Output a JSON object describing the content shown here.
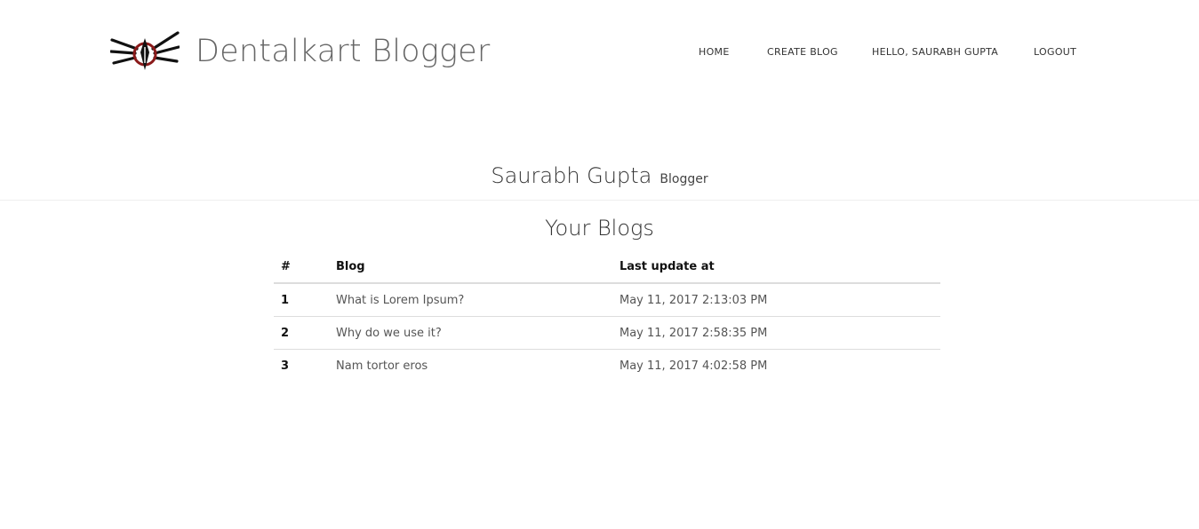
{
  "brand": {
    "title": "Dentalkart Blogger",
    "logo_icon": "winged-pen-logo-icon",
    "logo_accent_color": "#8b1a1a"
  },
  "nav": {
    "home": "HOME",
    "create_blog": "CREATE BLOG",
    "hello": "HELLO,  SAURABH GUPTA",
    "logout": "LOGOUT"
  },
  "profile": {
    "name": "Saurabh Gupta",
    "role": "Blogger"
  },
  "blogs": {
    "heading": "Your Blogs",
    "columns": [
      "#",
      "Blog",
      "Last update at"
    ],
    "rows": [
      {
        "num": "1",
        "title": "What is Lorem Ipsum?",
        "updated": "May 11, 2017 2:13:03 PM"
      },
      {
        "num": "2",
        "title": "Why do we use it?",
        "updated": "May 11, 2017 2:58:35 PM"
      },
      {
        "num": "3",
        "title": "Nam tortor eros",
        "updated": "May 11, 2017 4:02:58 PM"
      }
    ]
  }
}
